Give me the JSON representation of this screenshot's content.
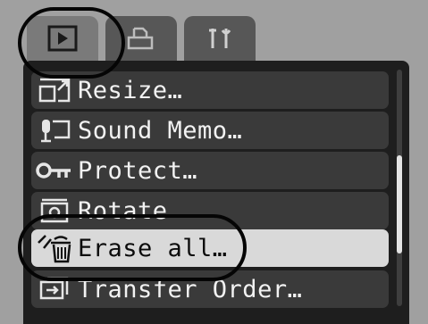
{
  "tabs": [
    {
      "id": "playback",
      "icon": "play-icon",
      "active": true
    },
    {
      "id": "print",
      "icon": "print-icon",
      "active": false
    },
    {
      "id": "setup",
      "icon": "setup-icon",
      "active": false
    }
  ],
  "menu": {
    "items": [
      {
        "label": "Resize…",
        "icon": "resize-icon"
      },
      {
        "label": "Sound Memo…",
        "icon": "microphone-icon"
      },
      {
        "label": "Protect…",
        "icon": "key-icon"
      },
      {
        "label": "Rotate",
        "icon": "rotate-icon"
      },
      {
        "label": "Erase all…",
        "icon": "erase-icon",
        "selected": true
      },
      {
        "label": "Transfer Order…",
        "icon": "transfer-order-icon"
      }
    ]
  },
  "scrollbar": {
    "position_fraction": 0.62
  },
  "colors": {
    "selected_bg": "#d9d9d9",
    "item_bg": "#3a3a3a",
    "callout": "#050505"
  }
}
